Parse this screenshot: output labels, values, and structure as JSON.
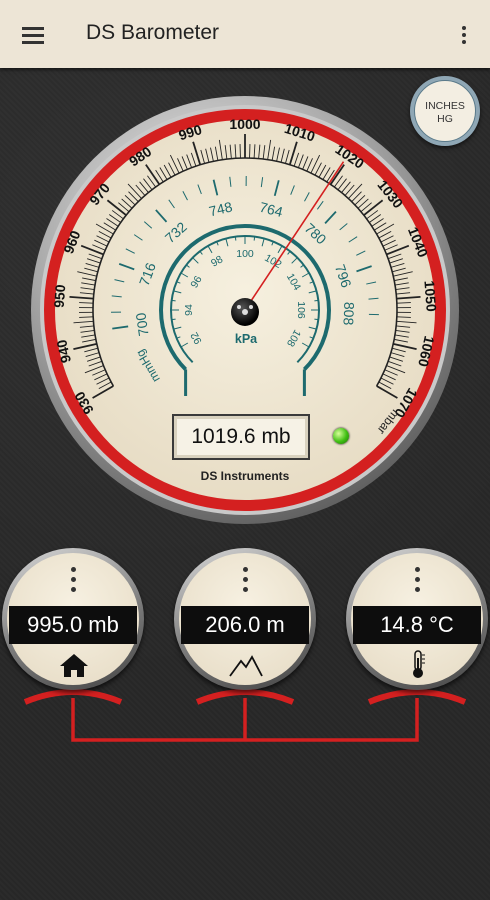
{
  "app": {
    "title": "DS Barometer"
  },
  "toolbar": {
    "menu_icon": "hamburger-menu-icon",
    "more_icon": "more-vert-icon"
  },
  "unit_toggle": {
    "line1": "INCHES",
    "line2": "HG"
  },
  "gauge": {
    "mbar_ticks": [
      "930",
      "940",
      "950",
      "960",
      "970",
      "980",
      "990",
      "1000",
      "1010",
      "1020",
      "1030",
      "1040",
      "1050",
      "1060",
      "1070"
    ],
    "mbar_unit": "mbar",
    "mmhg_ticks": [
      "700",
      "716",
      "732",
      "748",
      "764",
      "780",
      "796",
      "808"
    ],
    "mmhg_unit": "mmHg",
    "kpa_ticks": [
      "92",
      "94",
      "96",
      "98",
      "100",
      "102",
      "104",
      "106",
      "108"
    ],
    "kpa_unit": "kPa",
    "needle_value_mbar": 1019.6,
    "reading": "1019.6 mb",
    "brand": "DS Instruments",
    "status_led": "#3fbf12"
  },
  "mini_gauges": [
    {
      "value": "995.0 mb",
      "icon": "home-icon"
    },
    {
      "value": "206.0 m",
      "icon": "mountain-icon"
    },
    {
      "value": "14.8 °C",
      "icon": "thermometer-icon"
    }
  ],
  "colors": {
    "accent_red": "#d42020",
    "teal": "#1d6a6e",
    "appbar": "#ede5d6"
  }
}
